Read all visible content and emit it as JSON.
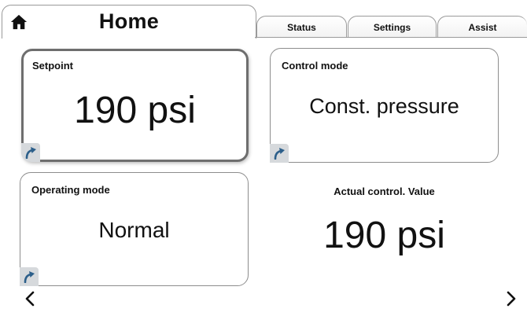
{
  "header": {
    "title": "Home",
    "home_icon": "home-icon",
    "tabs": [
      {
        "label": "Status"
      },
      {
        "label": "Settings"
      },
      {
        "label": "Assist"
      }
    ]
  },
  "cards": {
    "setpoint": {
      "label": "Setpoint",
      "value": "190 psi",
      "selected": true,
      "edit_icon": "edit-arrow-icon"
    },
    "control_mode": {
      "label": "Control mode",
      "value": "Const. pressure",
      "edit_icon": "edit-arrow-icon"
    },
    "operating_mode": {
      "label": "Operating mode",
      "value": "Normal",
      "edit_icon": "edit-arrow-icon"
    }
  },
  "actual": {
    "label": "Actual control. Value",
    "value": "190 psi"
  },
  "navigation": {
    "prev_icon": "chevron-left-icon",
    "next_icon": "chevron-right-icon"
  },
  "colors": {
    "accent": "#2c5f8a",
    "badge_bg": "#d6d9dc",
    "border": "#8d8d8d"
  }
}
